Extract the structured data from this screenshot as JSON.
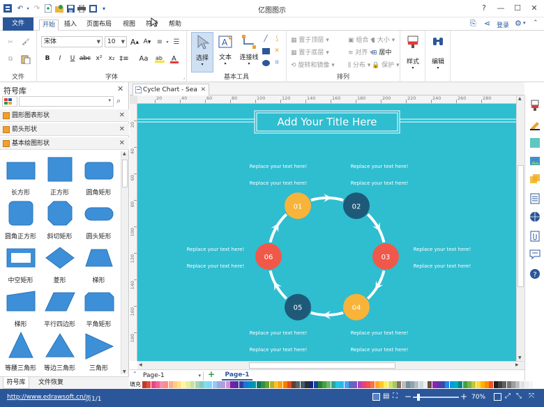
{
  "app": {
    "title": "亿图图示",
    "window_buttons": [
      "?",
      "—",
      "☐",
      "✕"
    ]
  },
  "ribbon_tabs": {
    "file": "文件",
    "tabs": [
      "开始",
      "插入",
      "页面布局",
      "视图",
      "符号",
      "帮助"
    ],
    "active": "开始",
    "login": "登录"
  },
  "ribbon": {
    "file_group": {
      "label": "文件"
    },
    "font_group": {
      "label": "字体",
      "font_name": "宋体",
      "font_size": "10"
    },
    "tools_group": {
      "label": "基本工具",
      "select": "选择",
      "text": "文本",
      "connector": "连接线"
    },
    "arrange_group": {
      "label": "排列",
      "bring_front": "置于顶层",
      "send_back": "置于底层",
      "rotate_flip": "旋转和镜像",
      "group": "组合",
      "align": "对齐",
      "distribute": "分布",
      "size": "大小",
      "center": "居中",
      "protect": "保护"
    },
    "style": {
      "label": "样式"
    },
    "edit": {
      "label": "编辑"
    }
  },
  "left_panel": {
    "title": "符号库",
    "categories": [
      {
        "name": "圆形图表形状"
      },
      {
        "name": "箭头形状"
      },
      {
        "name": "基本绘图形状"
      }
    ],
    "shapes": [
      {
        "label": "长方形",
        "shape": "rect"
      },
      {
        "label": "正方形",
        "shape": "square"
      },
      {
        "label": "圆角矩形",
        "shape": "roundrect"
      },
      {
        "label": "圆角正方形",
        "shape": "roundsquare"
      },
      {
        "label": "斜切矩形",
        "shape": "bevel"
      },
      {
        "label": "圆头矩形",
        "shape": "pill"
      },
      {
        "label": "中空矩形",
        "shape": "hollow"
      },
      {
        "label": "菱形",
        "shape": "diamond"
      },
      {
        "label": "梯形",
        "shape": "trapezoid"
      },
      {
        "label": "梯形",
        "shape": "trapezoid2"
      },
      {
        "label": "平行四边形",
        "shape": "parallelogram"
      },
      {
        "label": "平角矩形",
        "shape": "snipped"
      },
      {
        "label": "等腰三角形",
        "shape": "isotriangle"
      },
      {
        "label": "等边三角形",
        "shape": "eqtriangle"
      },
      {
        "label": "三角形",
        "shape": "triangle"
      }
    ],
    "bottom_tabs": [
      "符号库",
      "文件恢复"
    ]
  },
  "document": {
    "tab_title": "Cycle Chart - Sea",
    "ruler_h": [
      "20",
      "40",
      "60",
      "80",
      "100",
      "120",
      "140",
      "160",
      "180",
      "200",
      "220",
      "240",
      "260",
      "280"
    ],
    "ruler_v": [
      "20",
      "40",
      "60",
      "80",
      "100",
      "120",
      "140",
      "160",
      "180"
    ],
    "canvas": {
      "background": "#2fbdd0",
      "title": "Add Your Title Here",
      "placeholder": "Replace your text here!",
      "nodes": [
        {
          "label": "01",
          "color": "#f8b339"
        },
        {
          "label": "02",
          "color": "#1e5a78"
        },
        {
          "label": "03",
          "color": "#f0594a"
        },
        {
          "label": "04",
          "color": "#f8b339"
        },
        {
          "label": "05",
          "color": "#1e5a78"
        },
        {
          "label": "06",
          "color": "#f0594a"
        }
      ]
    }
  },
  "page_bar": {
    "page_select": "Page-1",
    "active_page": "Page-1"
  },
  "color_bar": {
    "label": "填充"
  },
  "status_bar": {
    "url": "http://www.edrawsoft.cn/",
    "page_info": "页1/1",
    "zoom": "70%"
  }
}
